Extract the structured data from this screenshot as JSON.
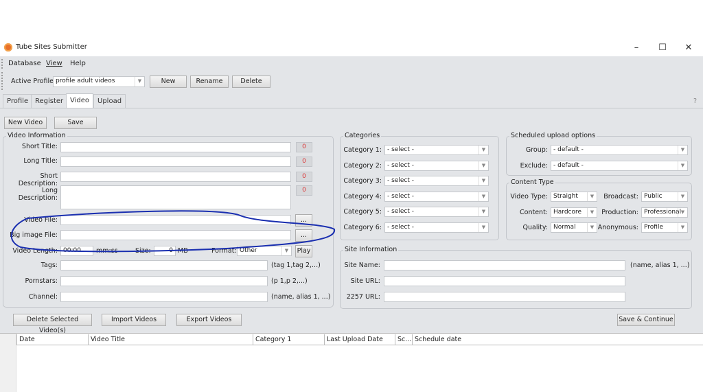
{
  "window": {
    "title": "Tube Sites Submitter",
    "controls": {
      "minimize": "–",
      "maximize": "☐",
      "close": "✕"
    }
  },
  "menu": [
    "Database",
    "View",
    "Help"
  ],
  "profile": {
    "label": "Active Profile:",
    "value": "profile adult videos",
    "buttons": {
      "new": "New",
      "rename": "Rename",
      "delete": "Delete"
    }
  },
  "tabs": [
    {
      "label": "Profile"
    },
    {
      "label": "Register"
    },
    {
      "label": "Video",
      "active": true
    },
    {
      "label": "Upload"
    }
  ],
  "help": "?",
  "toolbar": {
    "new_video": "New Video",
    "save": "Save"
  },
  "video_info": {
    "title": "Video Information",
    "short_title": {
      "label": "Short Title:",
      "value": "",
      "count": "0"
    },
    "long_title": {
      "label": "Long Title:",
      "value": "",
      "count": "0"
    },
    "short_desc": {
      "label": "Short Description:",
      "value": "",
      "count": "0"
    },
    "long_desc": {
      "label": "Long Description:",
      "value": "",
      "count": "0"
    },
    "video_file": {
      "label": "Video File:",
      "value": "",
      "browse": "..."
    },
    "big_image": {
      "label": "Big image File:",
      "value": "",
      "browse": "..."
    },
    "length": {
      "label": "Video Length:",
      "value": "00:00",
      "unit": "mm:ss"
    },
    "size": {
      "label": "Size:",
      "value": "0",
      "unit": "MB"
    },
    "format": {
      "label": "Format:",
      "value": "Other"
    },
    "play": "Play",
    "tags": {
      "label": "Tags:",
      "value": "",
      "hint": "(tag 1,tag 2,...)"
    },
    "pornstars": {
      "label": "Pornstars:",
      "value": "",
      "hint": "(p 1,p 2,...)"
    },
    "channel": {
      "label": "Channel:",
      "value": "",
      "hint": "(name, alias 1, ...)"
    }
  },
  "categories": {
    "title": "Categories",
    "items": [
      {
        "label": "Category 1:",
        "value": "- select -"
      },
      {
        "label": "Category 2:",
        "value": "- select -"
      },
      {
        "label": "Category 3:",
        "value": "- select -"
      },
      {
        "label": "Category 4:",
        "value": "- select -"
      },
      {
        "label": "Category 5:",
        "value": "- select -"
      },
      {
        "label": "Category 6:",
        "value": "- select -"
      }
    ]
  },
  "scheduled": {
    "title": "Scheduled upload options",
    "group": {
      "label": "Group:",
      "value": "- default -"
    },
    "exclude": {
      "label": "Exclude:",
      "value": "- default -"
    }
  },
  "content_type": {
    "title": "Content Type",
    "video_type": {
      "label": "Video Type:",
      "value": "Straight"
    },
    "broadcast": {
      "label": "Broadcast:",
      "value": "Public"
    },
    "content": {
      "label": "Content:",
      "value": "Hardcore"
    },
    "production": {
      "label": "Production:",
      "value": "Professional"
    },
    "quality": {
      "label": "Quality:",
      "value": "Normal"
    },
    "anonymous": {
      "label": "Anonymous:",
      "value": "Profile"
    }
  },
  "site_info": {
    "title": "Site Information",
    "site_name": {
      "label": "Site Name:",
      "value": "",
      "hint": "(name, alias 1, ...)"
    },
    "site_url": {
      "label": "Site URL:",
      "value": ""
    },
    "url_2257": {
      "label": "2257 URL:",
      "value": ""
    }
  },
  "actions": {
    "delete_selected": "Delete Selected Video(s)",
    "import": "Import Videos",
    "export": "Export Videos",
    "save_continue": "Save & Continue"
  },
  "table": {
    "columns": [
      "Date",
      "Video Title",
      "Category 1",
      "Last Upload Date",
      "Sc...",
      "Schedule date"
    ],
    "rows": []
  },
  "annotation": {
    "color": "#1a2fb0"
  }
}
